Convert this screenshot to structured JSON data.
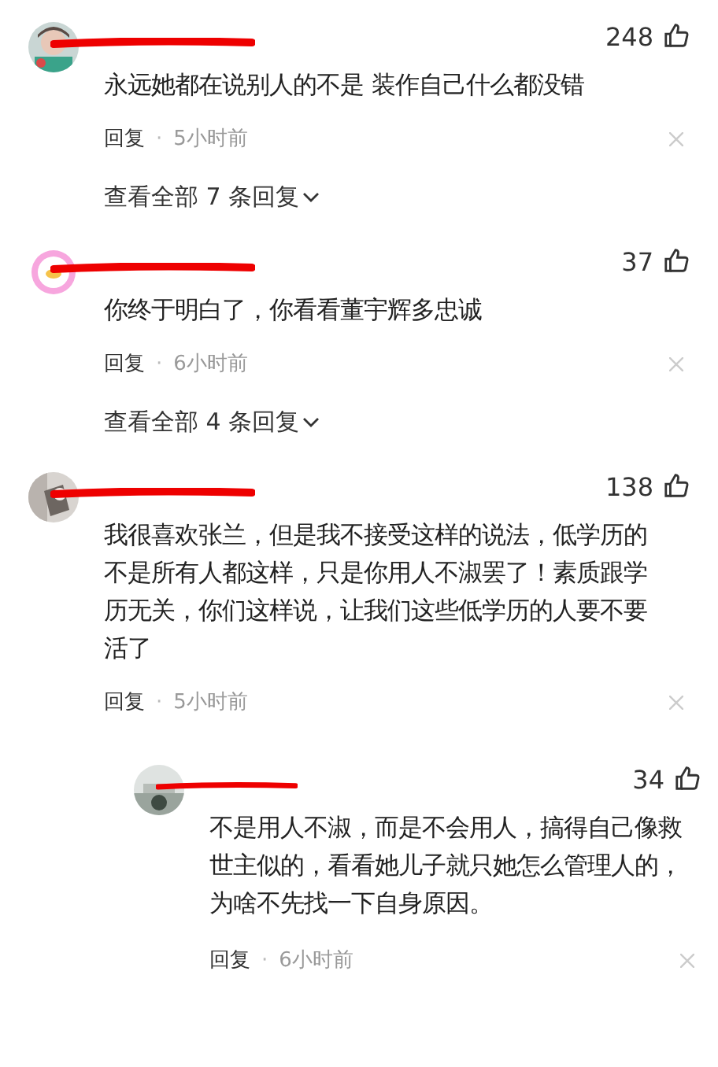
{
  "comments": [
    {
      "likes": "248",
      "text": "永远她都在说别人的不是 装作自己什么都没错",
      "reply_label": "回复",
      "separator": "·",
      "time": "5小时前",
      "view_replies": "查看全部 7 条回复"
    },
    {
      "likes": "37",
      "text": "你终于明白了，你看看董宇辉多忠诚",
      "reply_label": "回复",
      "separator": "·",
      "time": "6小时前",
      "view_replies": "查看全部 4 条回复"
    },
    {
      "likes": "138",
      "text": "我很喜欢张兰，但是我不接受这样的说法，低学历的不是所有人都这样，只是你用人不淑罢了！素质跟学历无关，你们这样说，让我们这些低学历的人要不要活了",
      "reply_label": "回复",
      "separator": "·",
      "time": "5小时前",
      "replies": [
        {
          "likes": "34",
          "text": "不是用人不淑，而是不会用人，搞得自己像救世主似的，看看她儿子就只她怎么管理人的，为啥不先找一下自身原因。",
          "reply_label": "回复",
          "separator": "·",
          "time": "6小时前"
        }
      ]
    }
  ]
}
